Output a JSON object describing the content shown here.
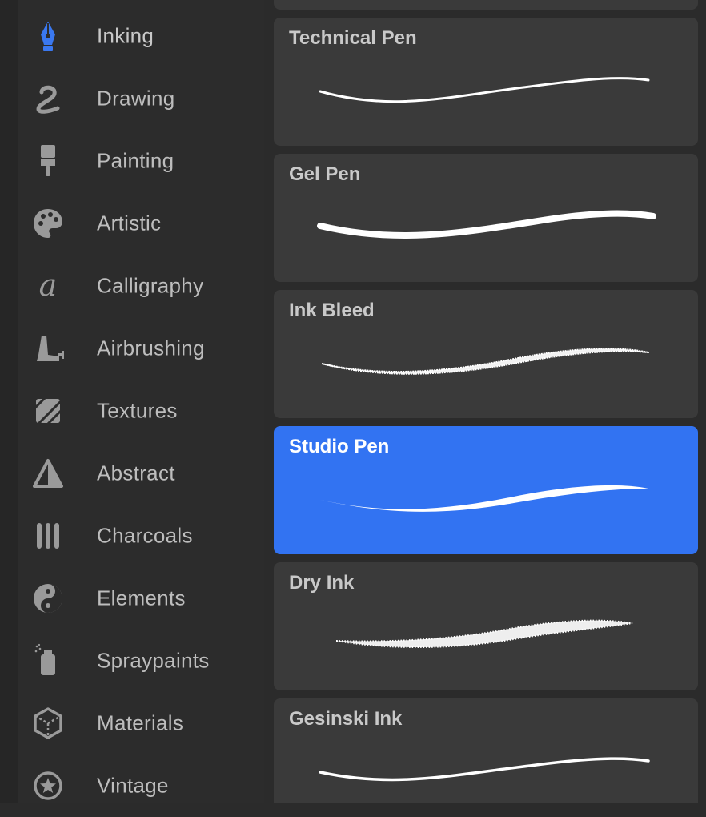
{
  "sidebar": {
    "items": [
      {
        "label": "Inking",
        "icon": "pen-nib-icon",
        "active": true
      },
      {
        "label": "Drawing",
        "icon": "squiggle-icon"
      },
      {
        "label": "Painting",
        "icon": "paintbrush-icon"
      },
      {
        "label": "Artistic",
        "icon": "palette-icon"
      },
      {
        "label": "Calligraphy",
        "icon": "calligraphy-a-icon"
      },
      {
        "label": "Airbrushing",
        "icon": "airbrush-icon"
      },
      {
        "label": "Textures",
        "icon": "hatched-square-icon"
      },
      {
        "label": "Abstract",
        "icon": "triangle-icon"
      },
      {
        "label": "Charcoals",
        "icon": "charcoal-sticks-icon"
      },
      {
        "label": "Elements",
        "icon": "yin-yang-icon"
      },
      {
        "label": "Spraypaints",
        "icon": "spray-can-icon"
      },
      {
        "label": "Materials",
        "icon": "cube-icon"
      },
      {
        "label": "Vintage",
        "icon": "star-circle-icon"
      }
    ]
  },
  "brushes": {
    "items": [
      {
        "name": "Technical Pen",
        "stroke": "thin"
      },
      {
        "name": "Gel Pen",
        "stroke": "round"
      },
      {
        "name": "Ink Bleed",
        "stroke": "bleed"
      },
      {
        "name": "Studio Pen",
        "stroke": "tapered",
        "selected": true
      },
      {
        "name": "Dry Ink",
        "stroke": "dry"
      },
      {
        "name": "Gesinski Ink",
        "stroke": "thin"
      }
    ]
  },
  "colors": {
    "accent": "#3273f2",
    "active_icon": "#3a78f0",
    "icon": "#9a9a9a",
    "card": "#3a3a3a",
    "background": "#2b2b2b"
  }
}
